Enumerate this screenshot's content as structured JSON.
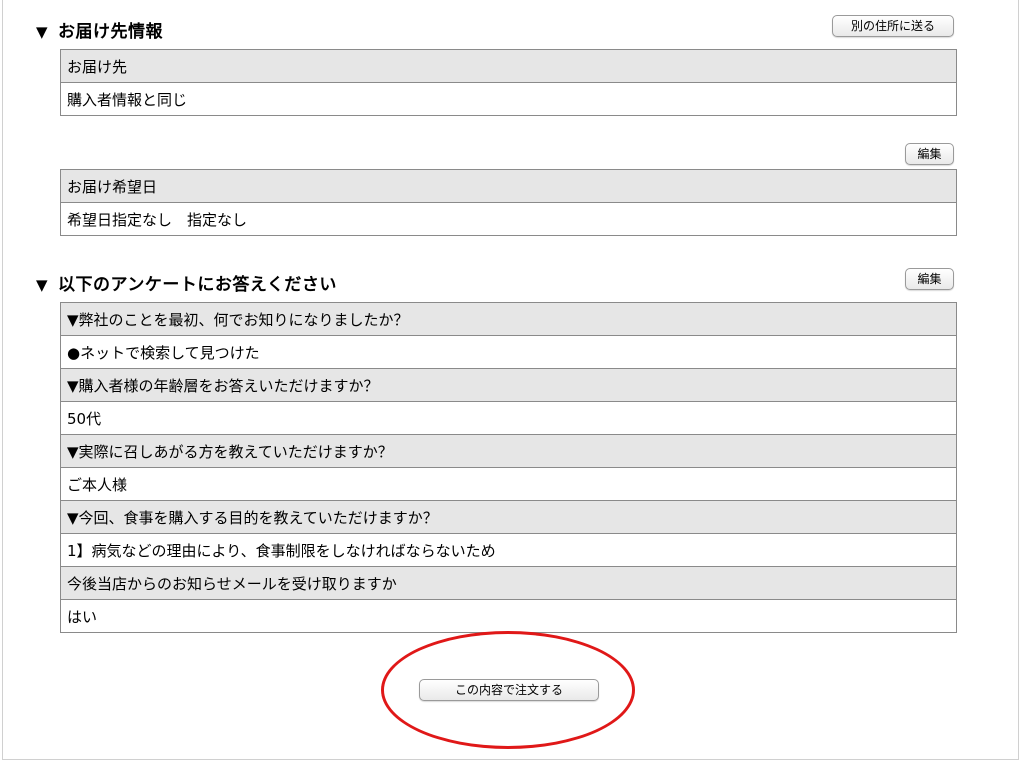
{
  "delivery": {
    "heading": "お届け先情報",
    "other_address_button": "別の住所に送る",
    "address_label": "お届け先",
    "address_value": "購入者情報と同じ",
    "edit_button": "編集",
    "date_label": "お届け希望日",
    "date_value": "希望日指定なし　指定なし"
  },
  "survey": {
    "heading": "以下のアンケートにお答えください",
    "edit_button": "編集",
    "items": [
      {
        "question": "▼弊社のことを最初、何でお知りになりましたか？",
        "answer": "●ネットで検索して見つけた"
      },
      {
        "question": "▼購入者様の年齢層をお答えいただけますか？",
        "answer": "50代"
      },
      {
        "question": "▼実際に召しあがる方を教えていただけますか？",
        "answer": "ご本人様"
      },
      {
        "question": "▼今回、食事を購入する目的を教えていただけますか？",
        "answer": "1】病気などの理由により、食事制限をしなければならないため"
      },
      {
        "question": "今後当店からのお知らせメールを受け取りますか",
        "answer": "はい"
      }
    ]
  },
  "order_button": "この内容で注文する",
  "colors": {
    "question_bg": "#e6e6e6",
    "border": "#8a8a8a",
    "highlight_circle": "#e01818"
  }
}
